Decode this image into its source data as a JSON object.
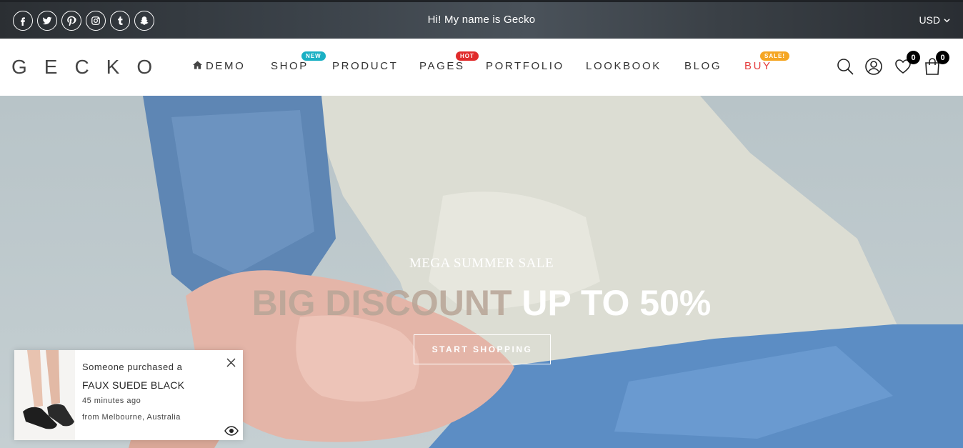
{
  "topbar": {
    "greeting": "Hi! My name is Gecko",
    "currency": "USD",
    "social": [
      "facebook-icon",
      "twitter-icon",
      "pinterest-icon",
      "instagram-icon",
      "tumblr-icon",
      "snapchat-icon"
    ]
  },
  "header": {
    "logo": "GECKO",
    "nav": [
      {
        "label": "DEMO",
        "icon": "home-icon"
      },
      {
        "label": "SHOP",
        "badge": "NEW",
        "badge_color": "#1ab0c4"
      },
      {
        "label": "PRODUCT"
      },
      {
        "label": "PAGES",
        "badge": "HOT",
        "badge_color": "#e02b2b"
      },
      {
        "label": "PORTFOLIO"
      },
      {
        "label": "LOOKBOOK"
      },
      {
        "label": "BLOG"
      },
      {
        "label": "BUY",
        "badge": "SALE!",
        "badge_color": "#f5a623",
        "color": "#e53e3e"
      }
    ],
    "wishlist_count": "0",
    "cart_count": "0"
  },
  "hero": {
    "kicker": "MEGA SUMMER SALE",
    "headline_muted": "BIG DISCOUNT",
    "headline_bright": "UP TO 50%",
    "cta": "START SHOPPING"
  },
  "popup": {
    "line1": "Someone purchased a",
    "product_name": "FAUX SUEDE BLACK",
    "time": "45 minutes ago",
    "location": "from Melbourne, Australia"
  }
}
